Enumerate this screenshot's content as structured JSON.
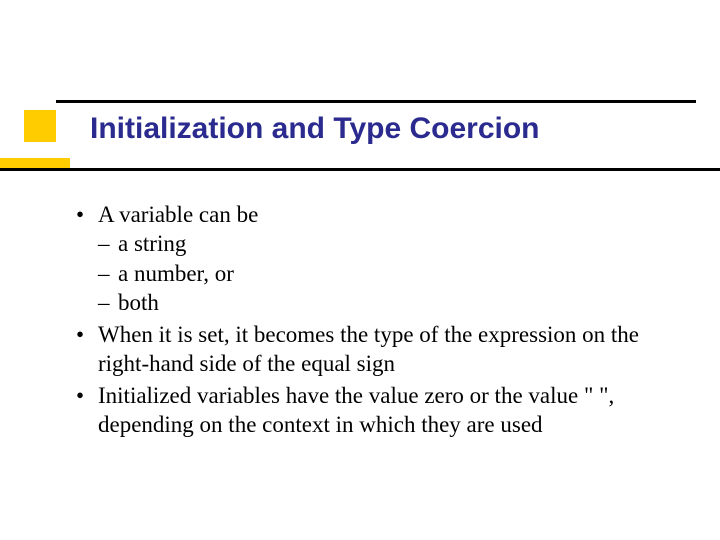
{
  "title": "Initialization and Type Coercion",
  "bullets": {
    "b1": "A variable can be",
    "b1_subs": {
      "s1": "a string",
      "s2": "a number, or",
      "s3": "both"
    },
    "b2": "When it is set, it becomes the type of the expression on the right-hand side of the equal sign",
    "b3": "Initialized variables have the value zero or the value \" \", depending on the context in which they are used"
  }
}
